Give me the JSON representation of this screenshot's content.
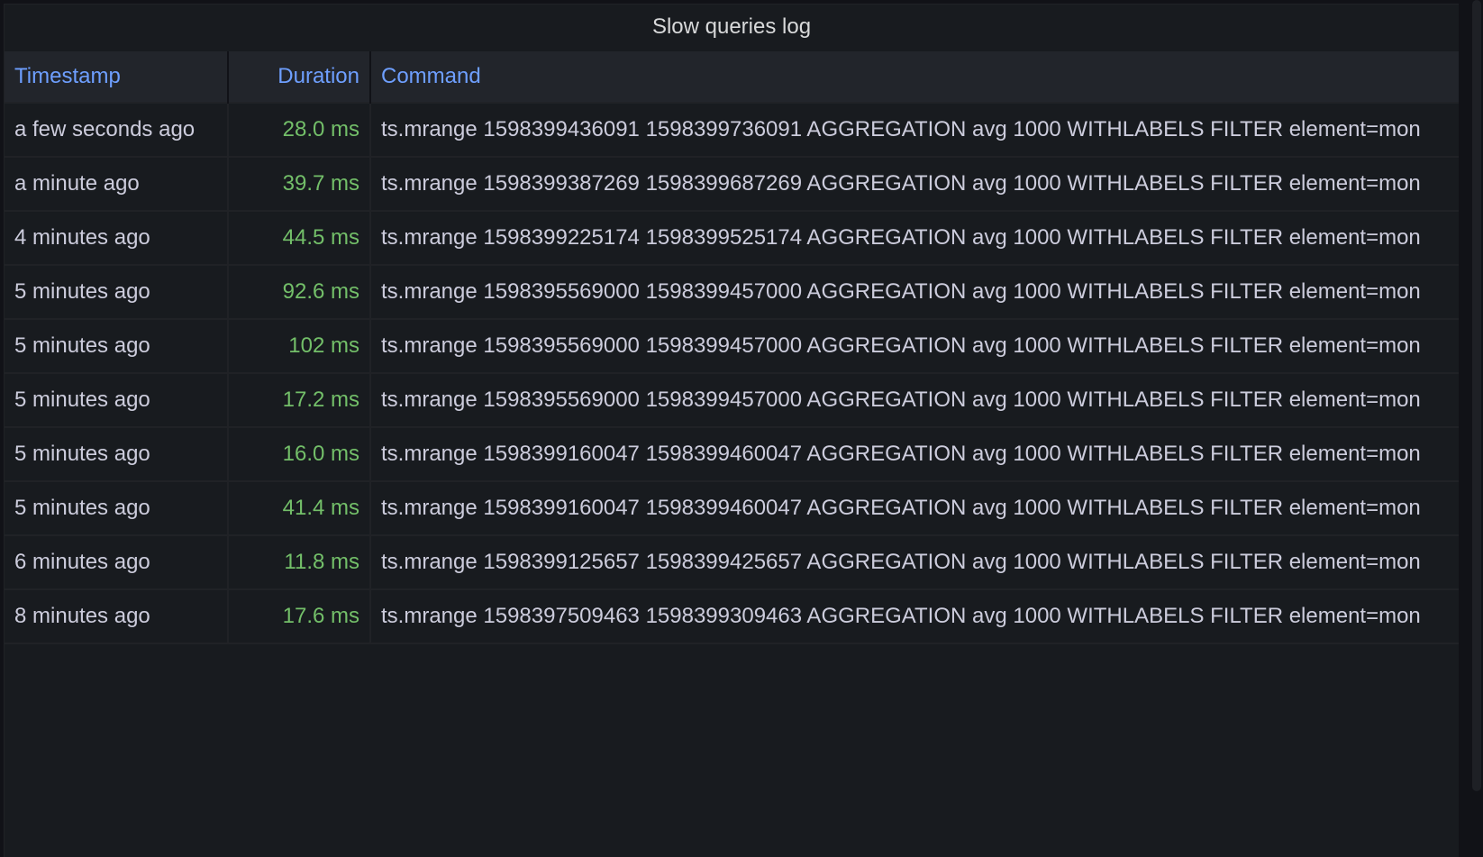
{
  "panel": {
    "title": "Slow queries log"
  },
  "table": {
    "columns": [
      "Timestamp",
      "Duration",
      "Command"
    ],
    "rows": [
      {
        "timestamp": "a few seconds ago",
        "duration": "28.0 ms",
        "command": "ts.mrange 1598399436091 1598399736091 AGGREGATION avg 1000 WITHLABELS FILTER element=mon"
      },
      {
        "timestamp": "a minute ago",
        "duration": "39.7 ms",
        "command": "ts.mrange 1598399387269 1598399687269 AGGREGATION avg 1000 WITHLABELS FILTER element=mon"
      },
      {
        "timestamp": "4 minutes ago",
        "duration": "44.5 ms",
        "command": "ts.mrange 1598399225174 1598399525174 AGGREGATION avg 1000 WITHLABELS FILTER element=mon"
      },
      {
        "timestamp": "5 minutes ago",
        "duration": "92.6 ms",
        "command": "ts.mrange 1598395569000 1598399457000 AGGREGATION avg 1000 WITHLABELS FILTER element=mon"
      },
      {
        "timestamp": "5 minutes ago",
        "duration": "102 ms",
        "command": "ts.mrange 1598395569000 1598399457000 AGGREGATION avg 1000 WITHLABELS FILTER element=mon"
      },
      {
        "timestamp": "5 minutes ago",
        "duration": "17.2 ms",
        "command": "ts.mrange 1598395569000 1598399457000 AGGREGATION avg 1000 WITHLABELS FILTER element=mon"
      },
      {
        "timestamp": "5 minutes ago",
        "duration": "16.0 ms",
        "command": "ts.mrange 1598399160047 1598399460047 AGGREGATION avg 1000 WITHLABELS FILTER element=mon"
      },
      {
        "timestamp": "5 minutes ago",
        "duration": "41.4 ms",
        "command": "ts.mrange 1598399160047 1598399460047 AGGREGATION avg 1000 WITHLABELS FILTER element=mon"
      },
      {
        "timestamp": "6 minutes ago",
        "duration": "11.8 ms",
        "command": "ts.mrange 1598399125657 1598399425657 AGGREGATION avg 1000 WITHLABELS FILTER element=mon"
      },
      {
        "timestamp": "8 minutes ago",
        "duration": "17.6 ms",
        "command": "ts.mrange 1598397509463 1598399309463 AGGREGATION avg 1000 WITHLABELS FILTER element=mon"
      }
    ]
  },
  "colors": {
    "header_text": "#6e9fff",
    "duration_text": "#73bf69",
    "cell_text": "#ccccdc",
    "panel_bg": "#181b1f",
    "page_bg": "#111217"
  }
}
